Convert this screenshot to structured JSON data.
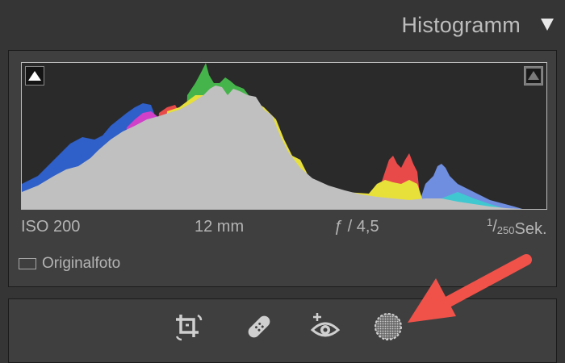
{
  "header": {
    "title": "Histogramm",
    "collapse_icon": "triangle-down-icon"
  },
  "histogram": {
    "clipping_left_icon": "shadow-clipping-triangle-icon",
    "clipping_right_icon": "highlight-clipping-triangle-icon",
    "colors": {
      "luminance": "#c0c0c0",
      "blue": "#2f5fc8",
      "yellow": "#e8e03a",
      "red": "#e84a4a",
      "green": "#45b44a",
      "magenta": "#d040c8",
      "cyan": "#40c8d0"
    }
  },
  "exif": {
    "iso": "ISO 200",
    "focal_length": "12 mm",
    "aperture": "ƒ / 4,5",
    "shutter_numerator": "1",
    "shutter_denominator": "250",
    "shutter_unit": "Sek."
  },
  "original_photo": {
    "label": "Originalfoto"
  },
  "tools": [
    {
      "icon": "crop-icon"
    },
    {
      "icon": "spot-removal-icon"
    },
    {
      "icon": "red-eye-icon"
    },
    {
      "icon": "masking-icon"
    }
  ],
  "annotation": {
    "arrow_color": "#f0524a"
  }
}
